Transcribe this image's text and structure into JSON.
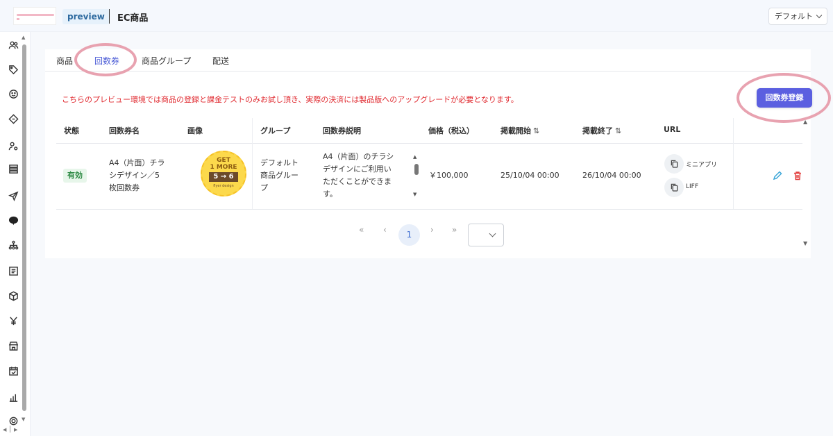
{
  "header": {
    "preview_label": "preview",
    "page_title": "EC商品",
    "profile_select": "デフォルト"
  },
  "tabs": [
    {
      "label": "商品",
      "active": false
    },
    {
      "label": "回数券",
      "active": true
    },
    {
      "label": "商品グループ",
      "active": false
    },
    {
      "label": "配送",
      "active": false
    }
  ],
  "notice": "こちらのプレビュー環境では商品の登録と課金テストのみお試し頂き、実際の決済には製品版へのアップグレードが必要となります。",
  "register_button": "回数券登録",
  "table": {
    "columns": [
      "状態",
      "回数券名",
      "画像",
      "グループ",
      "回数券説明",
      "価格（税込）",
      "掲載開始",
      "掲載終了",
      "URL"
    ],
    "sort_icon": "⇅",
    "rows": [
      {
        "status": "有効",
        "name_lines": [
          "A4（片面）チラ",
          "シデザイン／5",
          "枚回数券"
        ],
        "image_text": [
          "GET",
          "1 MORE",
          "5 → 6",
          "flyer design"
        ],
        "group_lines": [
          "デフォルト",
          "商品グルー",
          "プ"
        ],
        "description_lines": [
          "A4（片面）のチラシ",
          "デザインにご利用い",
          "ただくことができま",
          "す。"
        ],
        "price": "￥100,000",
        "start": "25/10/04 00:00",
        "end": "26/10/04 00:00",
        "url_links": [
          "ミニアプリ",
          "LIFF"
        ]
      }
    ]
  },
  "pagination": {
    "first": "«",
    "prev": "‹",
    "current": "1",
    "next": "›",
    "last": "»"
  },
  "icons": {
    "sidebar": [
      "users-icon",
      "tag-icon",
      "smile-icon",
      "coupon-icon",
      "user-settings-icon",
      "list-icon",
      "send-icon",
      "line-icon",
      "org-chart-icon",
      "document-icon",
      "box-icon",
      "yen-icon",
      "store-icon",
      "calendar-check-icon",
      "bar-chart-icon",
      "gear-icon"
    ]
  },
  "colors": {
    "accent": "#5b5fe0",
    "notice": "#e0292f",
    "status_active_bg": "#e7f6ea",
    "highlight_circle": "#e8a2b0"
  }
}
